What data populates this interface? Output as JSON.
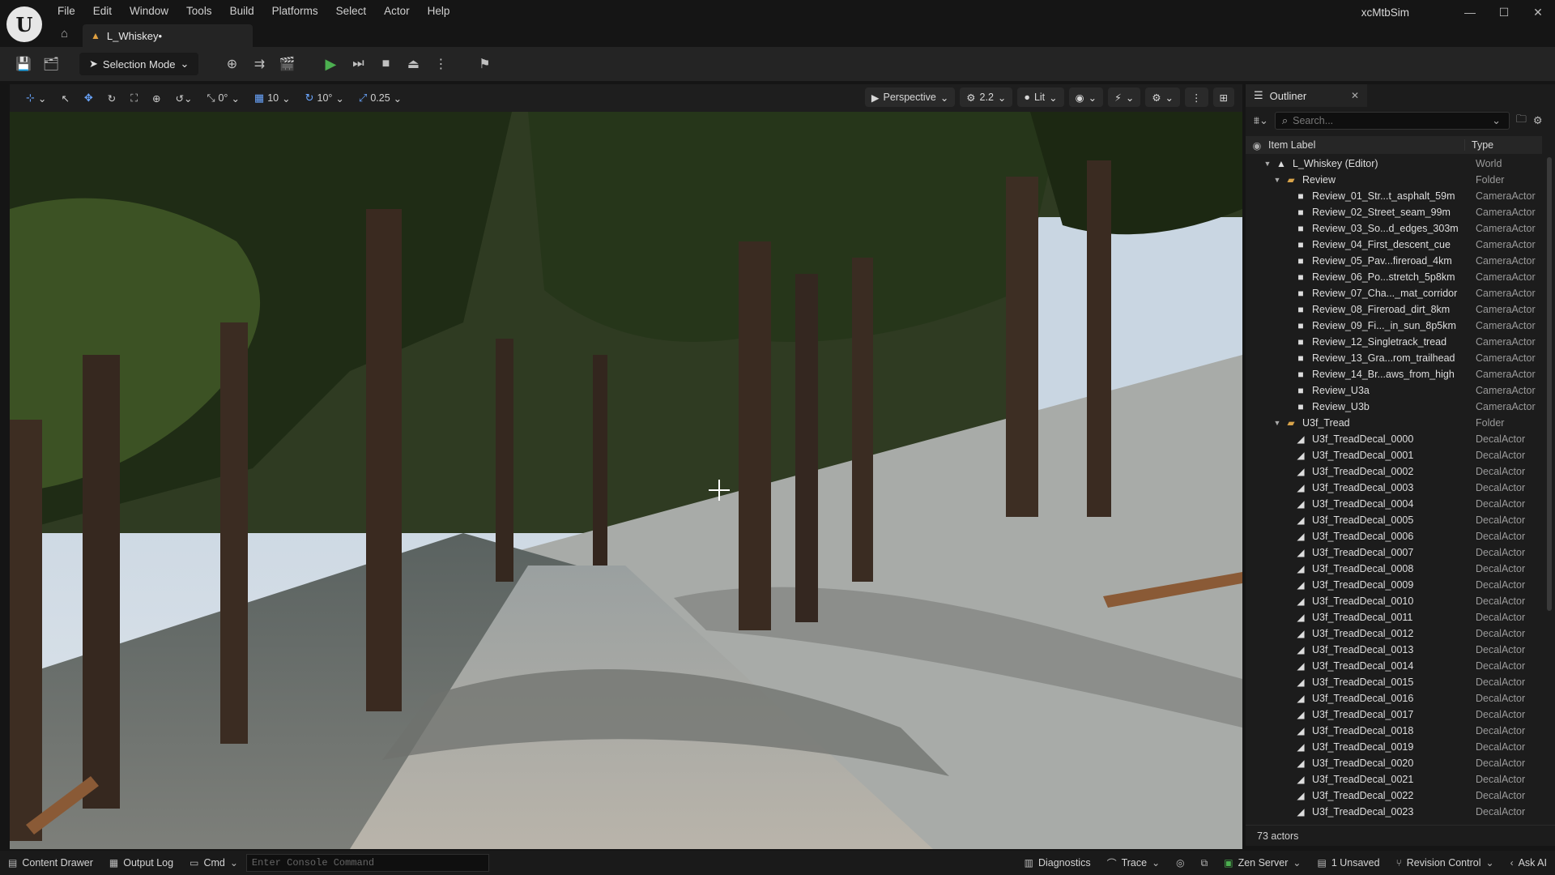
{
  "menu": [
    "File",
    "Edit",
    "Window",
    "Tools",
    "Build",
    "Platforms",
    "Select",
    "Actor",
    "Help"
  ],
  "document_tab": {
    "label": "L_Whiskey•"
  },
  "app_title": "xcMtbSim",
  "toolbar": {
    "selection_mode": "Selection Mode"
  },
  "viewport_toolbar": {
    "rotate_snap": "0°",
    "grid_snap": "10",
    "angle_snap": "10°",
    "scale_snap": "0.25",
    "view_mode": "Perspective",
    "camera_speed": "2.2",
    "lighting": "Lit"
  },
  "outliner": {
    "tab_label": "Outliner",
    "search_placeholder": "Search...",
    "col_label": "Item Label",
    "col_type": "Type",
    "rows": [
      {
        "label": "L_Whiskey (Editor)",
        "type": "World",
        "depth": 1,
        "icon": "world"
      },
      {
        "label": "Review",
        "type": "Folder",
        "depth": 2,
        "icon": "folder"
      },
      {
        "label": "Review_01_Str...t_asphalt_59m",
        "type": "CameraActor",
        "depth": 3,
        "icon": "camera"
      },
      {
        "label": "Review_02_Street_seam_99m",
        "type": "CameraActor",
        "depth": 3,
        "icon": "camera"
      },
      {
        "label": "Review_03_So...d_edges_303m",
        "type": "CameraActor",
        "depth": 3,
        "icon": "camera"
      },
      {
        "label": "Review_04_First_descent_cue",
        "type": "CameraActor",
        "depth": 3,
        "icon": "camera"
      },
      {
        "label": "Review_05_Pav...fireroad_4km",
        "type": "CameraActor",
        "depth": 3,
        "icon": "camera"
      },
      {
        "label": "Review_06_Po...stretch_5p8km",
        "type": "CameraActor",
        "depth": 3,
        "icon": "camera"
      },
      {
        "label": "Review_07_Cha..._mat_corridor",
        "type": "CameraActor",
        "depth": 3,
        "icon": "camera"
      },
      {
        "label": "Review_08_Fireroad_dirt_8km",
        "type": "CameraActor",
        "depth": 3,
        "icon": "camera"
      },
      {
        "label": "Review_09_Fi..._in_sun_8p5km",
        "type": "CameraActor",
        "depth": 3,
        "icon": "camera"
      },
      {
        "label": "Review_12_Singletrack_tread",
        "type": "CameraActor",
        "depth": 3,
        "icon": "camera"
      },
      {
        "label": "Review_13_Gra...rom_trailhead",
        "type": "CameraActor",
        "depth": 3,
        "icon": "camera"
      },
      {
        "label": "Review_14_Br...aws_from_high",
        "type": "CameraActor",
        "depth": 3,
        "icon": "camera"
      },
      {
        "label": "Review_U3a",
        "type": "CameraActor",
        "depth": 3,
        "icon": "camera"
      },
      {
        "label": "Review_U3b",
        "type": "CameraActor",
        "depth": 3,
        "icon": "camera"
      },
      {
        "label": "U3f_Tread",
        "type": "Folder",
        "depth": 2,
        "icon": "folder"
      },
      {
        "label": "U3f_TreadDecal_0000",
        "type": "DecalActor",
        "depth": 3,
        "icon": "decal"
      },
      {
        "label": "U3f_TreadDecal_0001",
        "type": "DecalActor",
        "depth": 3,
        "icon": "decal"
      },
      {
        "label": "U3f_TreadDecal_0002",
        "type": "DecalActor",
        "depth": 3,
        "icon": "decal"
      },
      {
        "label": "U3f_TreadDecal_0003",
        "type": "DecalActor",
        "depth": 3,
        "icon": "decal"
      },
      {
        "label": "U3f_TreadDecal_0004",
        "type": "DecalActor",
        "depth": 3,
        "icon": "decal"
      },
      {
        "label": "U3f_TreadDecal_0005",
        "type": "DecalActor",
        "depth": 3,
        "icon": "decal"
      },
      {
        "label": "U3f_TreadDecal_0006",
        "type": "DecalActor",
        "depth": 3,
        "icon": "decal"
      },
      {
        "label": "U3f_TreadDecal_0007",
        "type": "DecalActor",
        "depth": 3,
        "icon": "decal"
      },
      {
        "label": "U3f_TreadDecal_0008",
        "type": "DecalActor",
        "depth": 3,
        "icon": "decal"
      },
      {
        "label": "U3f_TreadDecal_0009",
        "type": "DecalActor",
        "depth": 3,
        "icon": "decal"
      },
      {
        "label": "U3f_TreadDecal_0010",
        "type": "DecalActor",
        "depth": 3,
        "icon": "decal"
      },
      {
        "label": "U3f_TreadDecal_0011",
        "type": "DecalActor",
        "depth": 3,
        "icon": "decal"
      },
      {
        "label": "U3f_TreadDecal_0012",
        "type": "DecalActor",
        "depth": 3,
        "icon": "decal"
      },
      {
        "label": "U3f_TreadDecal_0013",
        "type": "DecalActor",
        "depth": 3,
        "icon": "decal"
      },
      {
        "label": "U3f_TreadDecal_0014",
        "type": "DecalActor",
        "depth": 3,
        "icon": "decal"
      },
      {
        "label": "U3f_TreadDecal_0015",
        "type": "DecalActor",
        "depth": 3,
        "icon": "decal"
      },
      {
        "label": "U3f_TreadDecal_0016",
        "type": "DecalActor",
        "depth": 3,
        "icon": "decal"
      },
      {
        "label": "U3f_TreadDecal_0017",
        "type": "DecalActor",
        "depth": 3,
        "icon": "decal"
      },
      {
        "label": "U3f_TreadDecal_0018",
        "type": "DecalActor",
        "depth": 3,
        "icon": "decal"
      },
      {
        "label": "U3f_TreadDecal_0019",
        "type": "DecalActor",
        "depth": 3,
        "icon": "decal"
      },
      {
        "label": "U3f_TreadDecal_0020",
        "type": "DecalActor",
        "depth": 3,
        "icon": "decal"
      },
      {
        "label": "U3f_TreadDecal_0021",
        "type": "DecalActor",
        "depth": 3,
        "icon": "decal"
      },
      {
        "label": "U3f_TreadDecal_0022",
        "type": "DecalActor",
        "depth": 3,
        "icon": "decal"
      },
      {
        "label": "U3f_TreadDecal_0023",
        "type": "DecalActor",
        "depth": 3,
        "icon": "decal"
      }
    ],
    "actor_count": "73 actors"
  },
  "statusbar": {
    "content_drawer": "Content Drawer",
    "output_log": "Output Log",
    "cmd": "Cmd",
    "console_placeholder": "Enter Console Command",
    "diagnostics": "Diagnostics",
    "trace": "Trace",
    "zen_server": "Zen Server",
    "unsaved": "1 Unsaved",
    "revision_control": "Revision Control",
    "ask_ai": "Ask AI"
  },
  "colors": {
    "folder": "#d8a34a",
    "play": "#4caf50",
    "accent": "#6aa6ff"
  }
}
